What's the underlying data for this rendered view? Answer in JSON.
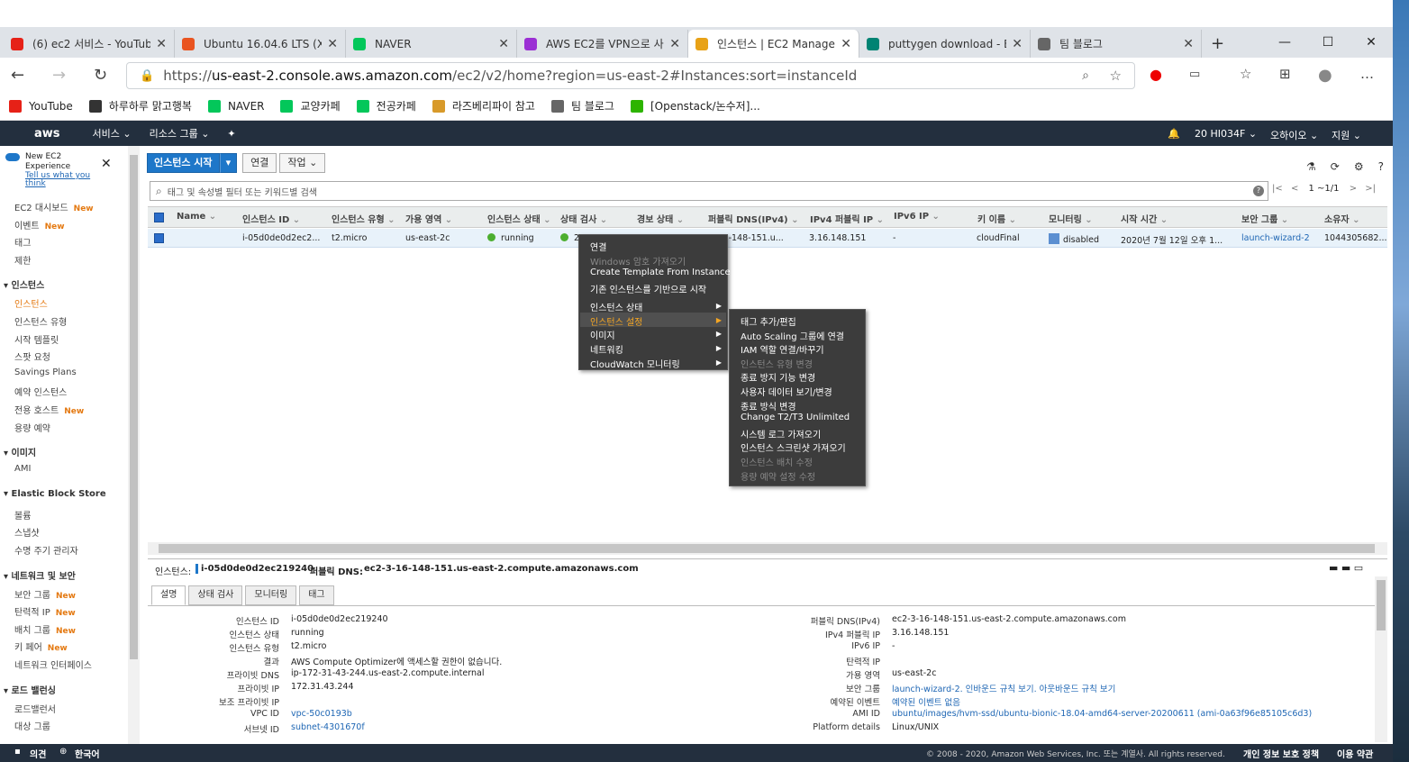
{
  "browser": {
    "tabs": [
      {
        "title": "(6) ec2 서비스 - YouTub",
        "icon": "youtube-icon",
        "color": "#e62117"
      },
      {
        "title": "Ubuntu 16.04.6 LTS (Xe",
        "icon": "ubuntu-icon",
        "color": "#e95420"
      },
      {
        "title": "NAVER",
        "icon": "naver-icon",
        "color": "#03c75a"
      },
      {
        "title": "AWS EC2를 VPN으로 사",
        "icon": "tab-icon",
        "color": "#9b2fd4"
      },
      {
        "title": "인스턴스 | EC2 Manage",
        "icon": "aws-box-icon",
        "color": "#e8a217"
      },
      {
        "title": "puttygen download - B",
        "icon": "bing-icon",
        "color": "#008373"
      },
      {
        "title": "팀 블로그",
        "icon": "page-icon",
        "color": "#666666"
      }
    ],
    "window_controls": [
      "—",
      "☐",
      "✕"
    ],
    "url_prefix": "https://",
    "url_host": "us-east-2.console.aws.amazon.com",
    "url_path": "/ec2/v2/home?region=us-east-2#Instances:sort=instanceId",
    "bookmarks": [
      {
        "label": "YouTube",
        "icon": "youtube-icon",
        "color": "#e62117"
      },
      {
        "label": "하루하루 맑고행복",
        "icon": "dots-icon",
        "color": "#333333"
      },
      {
        "label": "NAVER",
        "icon": "naver-icon",
        "color": "#03c75a"
      },
      {
        "label": "교양카페",
        "icon": "cafe-icon",
        "color": "#03c75a"
      },
      {
        "label": "전공카페",
        "icon": "cafe-icon",
        "color": "#03c75a"
      },
      {
        "label": "라즈베리파이 참고",
        "icon": "face-icon",
        "color": "#d89a2a"
      },
      {
        "label": "팀 블로그",
        "icon": "page-icon",
        "color": "#666666"
      },
      {
        "label": "[Openstack/논수저]...",
        "icon": "blog-icon",
        "color": "#2db400"
      }
    ]
  },
  "aws": {
    "logo": "aws",
    "menu": [
      "서비스 ⌄",
      "리소스 그룹 ⌄",
      "✦"
    ],
    "bell": "🔔",
    "account": "20  HI034F ⌄",
    "region": "오하이오 ⌄",
    "support": "지원 ⌄"
  },
  "sidebar": {
    "toggle_label": "New EC2 Experience",
    "toggle_link": "Tell us what you think",
    "top": [
      {
        "label": "EC2 대시보드",
        "new": "New"
      },
      {
        "label": "이벤트",
        "new": "New"
      },
      {
        "label": "태그",
        "new": ""
      },
      {
        "label": "제한",
        "new": ""
      }
    ],
    "sections": [
      {
        "title": "인스턴스",
        "items": [
          {
            "label": "인스턴스",
            "new": ""
          },
          {
            "label": "인스턴스 유형",
            "new": ""
          },
          {
            "label": "시작 템플릿",
            "new": ""
          },
          {
            "label": "스팟 요청",
            "new": ""
          },
          {
            "label": "Savings Plans",
            "new": ""
          },
          {
            "label": "예약 인스턴스",
            "new": ""
          },
          {
            "label": "전용 호스트",
            "new": "New"
          },
          {
            "label": "용량 예약",
            "new": ""
          }
        ]
      },
      {
        "title": "이미지",
        "items": [
          {
            "label": "AMI",
            "new": ""
          }
        ]
      },
      {
        "title": "Elastic Block Store",
        "items": [
          {
            "label": "볼륨",
            "new": ""
          },
          {
            "label": "스냅샷",
            "new": ""
          },
          {
            "label": "수명 주기 관리자",
            "new": ""
          }
        ]
      },
      {
        "title": "네트워크 및 보안",
        "items": [
          {
            "label": "보안 그룹",
            "new": "New"
          },
          {
            "label": "탄력적 IP",
            "new": "New"
          },
          {
            "label": "배치 그룹",
            "new": "New"
          },
          {
            "label": "키 페어",
            "new": "New"
          },
          {
            "label": "네트워크 인터페이스",
            "new": ""
          }
        ]
      },
      {
        "title": "로드 밸런싱",
        "items": [
          {
            "label": "로드밸런서",
            "new": ""
          },
          {
            "label": "대상 그룹",
            "new": ""
          }
        ]
      }
    ]
  },
  "toolbar": {
    "launch": "인스턴스 시작",
    "connect": "연결",
    "actions": "작업 ⌄",
    "filter_placeholder": "태그 및 속성별 필터 또는 키워드별 검색",
    "pager": "1 ~1/1"
  },
  "table": {
    "headers": [
      "Name",
      "인스턴스 ID",
      "인스턴스 유형",
      "가용 영역",
      "인스턴스 상태",
      "상태 검사",
      "경보 상태",
      "퍼블릭 DNS(IPv4)",
      "IPv4 퍼블릭 IP",
      "IPv6 IP",
      "키 이름",
      "모니터링",
      "시작 시간",
      "보안 그룹",
      "소유자"
    ],
    "row": {
      "instance_id": "i-05d0de0d2ec2...",
      "type": "t2.micro",
      "az": "us-east-2c",
      "state": "running",
      "check": "2",
      "dns": "...-16-148-151.u...",
      "ipv4": "3.16.148.151",
      "ipv6": "-",
      "key": "cloudFinal",
      "monitoring": "disabled",
      "launch": "2020년 7월 12일 오후 1...",
      "sg": "launch-wizard-2",
      "owner": "1044305682..."
    }
  },
  "context_menu": {
    "items": [
      {
        "label": "연결",
        "disabled": false,
        "sub": false
      },
      {
        "label": "Windows 암호 가져오기",
        "disabled": true,
        "sub": false
      },
      {
        "label": "Create Template From Instance",
        "disabled": false,
        "sub": false
      },
      {
        "label": "기존 인스턴스를 기반으로 시작",
        "disabled": false,
        "sub": false
      },
      {
        "label": "인스턴스 상태",
        "disabled": false,
        "sub": true
      },
      {
        "label": "인스턴스 설정",
        "disabled": false,
        "sub": true
      },
      {
        "label": "이미지",
        "disabled": false,
        "sub": true
      },
      {
        "label": "네트워킹",
        "disabled": false,
        "sub": true
      },
      {
        "label": "CloudWatch 모니터링",
        "disabled": false,
        "sub": true
      }
    ],
    "submenu": [
      {
        "label": "태그 추가/편집",
        "disabled": false
      },
      {
        "label": "Auto Scaling 그룹에 연결",
        "disabled": false
      },
      {
        "label": "IAM 역할 연결/바꾸기",
        "disabled": false
      },
      {
        "label": "인스턴스 유형 변경",
        "disabled": true
      },
      {
        "label": "종료 방지 기능 변경",
        "disabled": false
      },
      {
        "label": "사용자 데이터 보기/변경",
        "disabled": false
      },
      {
        "label": "종료 방식 변경",
        "disabled": false
      },
      {
        "label": "Change T2/T3 Unlimited",
        "disabled": false
      },
      {
        "label": "시스템 로그 가져오기",
        "disabled": false
      },
      {
        "label": "인스턴스 스크린샷 가져오기",
        "disabled": false
      },
      {
        "label": "인스턴스 배치 수정",
        "disabled": true
      },
      {
        "label": "용량 예약 설정 수정",
        "disabled": true
      }
    ]
  },
  "details": {
    "instance_label": "인스턴스:",
    "instance_id": "i-05d0de0d2ec219240",
    "dns_label": "퍼블릭 DNS:",
    "dns": "ec2-3-16-148-151.us-east-2.compute.amazonaws.com",
    "tabs": [
      "설명",
      "상태 검사",
      "모니터링",
      "태그"
    ],
    "left": [
      {
        "k": "인스턴스 ID",
        "v": "i-05d0de0d2ec219240",
        "link": false
      },
      {
        "k": "인스턴스 상태",
        "v": "running",
        "link": false
      },
      {
        "k": "인스턴스 유형",
        "v": "t2.micro",
        "link": false
      },
      {
        "k": "결과",
        "v": "AWS Compute Optimizer에 액세스할 권한이 없습니다.",
        "link": false
      },
      {
        "k": "프라이빗 DNS",
        "v": "ip-172-31-43-244.us-east-2.compute.internal",
        "link": false
      },
      {
        "k": "프라이빗 IP",
        "v": "172.31.43.244",
        "link": false
      },
      {
        "k": "보조 프라이빗 IP",
        "v": "",
        "link": false
      },
      {
        "k": "VPC ID",
        "v": "vpc-50c0193b",
        "link": true
      },
      {
        "k": "서브넷 ID",
        "v": "subnet-4301670f",
        "link": true
      }
    ],
    "right": [
      {
        "k": "퍼블릭 DNS(IPv4)",
        "v": "ec2-3-16-148-151.us-east-2.compute.amazonaws.com",
        "link": false
      },
      {
        "k": "IPv4 퍼블릭 IP",
        "v": "3.16.148.151",
        "link": false
      },
      {
        "k": "IPv6 IP",
        "v": "-",
        "link": false
      },
      {
        "k": "탄력적 IP",
        "v": "",
        "link": false
      },
      {
        "k": "가용 영역",
        "v": "us-east-2c",
        "link": false
      },
      {
        "k": "보안 그룹",
        "v": "launch-wizard-2. 인바운드 규칙 보기. 아웃바운드 규칙 보기",
        "link": true
      },
      {
        "k": "예약된 이벤트",
        "v": "예약된 이벤트 없음",
        "link": true
      },
      {
        "k": "AMI ID",
        "v": "ubuntu/images/hvm-ssd/ubuntu-bionic-18.04-amd64-server-20200611 (ami-0a63f96e85105c6d3)",
        "link": true
      },
      {
        "k": "Platform details",
        "v": "Linux/UNIX",
        "link": false
      }
    ]
  },
  "footer": {
    "feedback": "의견",
    "language": "한국어",
    "copyright": "© 2008 - 2020, Amazon Web Services, Inc. 또는 계열사. All rights reserved.",
    "privacy": "개인 정보 보호 정책",
    "terms": "이용 약관"
  }
}
